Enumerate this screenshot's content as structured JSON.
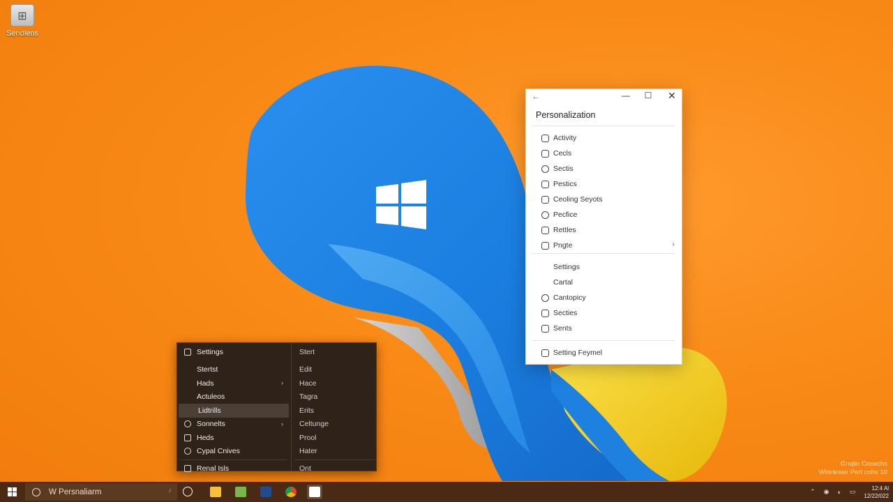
{
  "desktop": {
    "icon_label": "Sendlens"
  },
  "settings_window": {
    "heading": "Personalization",
    "section1": [
      {
        "label": "Activity",
        "icon": "brush-icon",
        "chevron": false
      },
      {
        "label": "Cecls",
        "icon": "palette-icon",
        "chevron": false
      },
      {
        "label": "Sectis",
        "icon": "window-icon",
        "chevron": false
      },
      {
        "label": "Pestics",
        "icon": "image-icon",
        "chevron": false
      },
      {
        "label": "Ceoling Seyots",
        "icon": "lock-icon",
        "chevron": false
      },
      {
        "label": "Pecfice",
        "icon": "theme-icon",
        "chevron": false
      },
      {
        "label": "Rettles",
        "icon": "font-icon",
        "chevron": false
      },
      {
        "label": "Pngte",
        "icon": "start-icon",
        "chevron": true
      }
    ],
    "section2": [
      {
        "label": "Settings",
        "icon": "",
        "chevron": false
      },
      {
        "label": "Cartal",
        "icon": "",
        "chevron": false
      },
      {
        "label": "Cantopicy",
        "icon": "refresh-icon",
        "chevron": false
      },
      {
        "label": "Secties",
        "icon": "globe-icon",
        "chevron": false
      },
      {
        "label": "Sents",
        "icon": "shield-icon",
        "chevron": false
      }
    ],
    "section3": [
      {
        "label": "Setting Feymel",
        "icon": "taskbar-icon",
        "chevron": false
      }
    ]
  },
  "context_menu": {
    "left": [
      {
        "label": "Settings",
        "icon": "gear-icon",
        "chevron": false
      },
      {
        "label": "Stertst",
        "icon": "",
        "chevron": false
      },
      {
        "label": "Hads",
        "icon": "",
        "chevron": true
      },
      {
        "label": "Actuleos",
        "icon": "",
        "chevron": false
      },
      {
        "label": "Lidtrills",
        "icon": "",
        "chevron": false,
        "active": true
      },
      {
        "label": "Sonnelts",
        "icon": "folder-icon",
        "chevron": true
      },
      {
        "label": "Heds",
        "icon": "copy-icon",
        "chevron": false
      },
      {
        "label": "Cypal Cnives",
        "icon": "drive-icon",
        "chevron": false
      },
      {
        "label": "Renal Isls",
        "icon": "power-icon",
        "chevron": false
      }
    ],
    "right": [
      {
        "label": "Stert"
      },
      {
        "label": "Edit"
      },
      {
        "label": "Hace"
      },
      {
        "label": "Tagra"
      },
      {
        "label": "Erits"
      },
      {
        "label": "Celtunge"
      },
      {
        "label": "Prool"
      },
      {
        "label": "Hater"
      },
      {
        "label": "Ont"
      }
    ]
  },
  "taskbar": {
    "search_text": "W Persnaliarm",
    "watermark_line1": "Gnqlin Crewchs",
    "watermark_line2": "Winrlewer Pert cnhs 10",
    "clock_time": "12:4 Al",
    "clock_date": "12/22/022"
  },
  "colors": {
    "wallpaper": "#f98a16",
    "swirl_blue": "#1e88e5",
    "swirl_yellow": "#f5d21c",
    "taskbar": "#4a2a14",
    "menu_bg": "#2f2319"
  }
}
